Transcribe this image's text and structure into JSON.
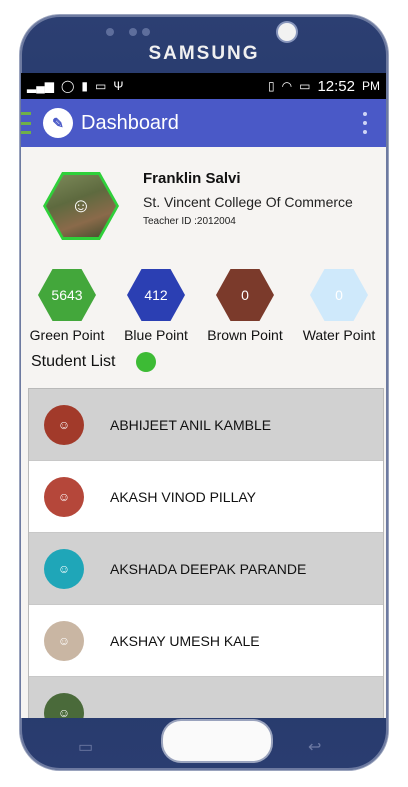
{
  "device": {
    "brand": "SAMSUNG"
  },
  "statusbar": {
    "left_icons": [
      "signal-icon",
      "whatsapp-icon",
      "battery-saver-icon",
      "message-icon",
      "usb-icon"
    ],
    "right_icons": [
      "vibrate-icon",
      "wifi-icon",
      "battery-icon"
    ],
    "time": "12:52",
    "ampm": "PM"
  },
  "appbar": {
    "title": "Dashboard"
  },
  "profile": {
    "name": "Franklin Salvi",
    "college": "St. Vincent College Of Commerce",
    "teacher_id": "Teacher ID :2012004"
  },
  "points": [
    {
      "value": "5643",
      "label": "Green Point",
      "color": "#43a73b"
    },
    {
      "value": "412",
      "label": "Blue Point",
      "color": "#2b3fb3"
    },
    {
      "value": "0",
      "label": "Brown Point",
      "color": "#7b3a2b"
    },
    {
      "value": "0",
      "label": "Water Point",
      "color": "#cfe9fb"
    }
  ],
  "student_list": {
    "label": "Student List",
    "status_color": "#3dbb35",
    "students": [
      {
        "name": "ABHIJEET ANIL KAMBLE"
      },
      {
        "name": "AKASH VINOD PILLAY"
      },
      {
        "name": "AKSHADA DEEPAK PARANDE"
      },
      {
        "name": "AKSHAY UMESH KALE"
      }
    ]
  }
}
